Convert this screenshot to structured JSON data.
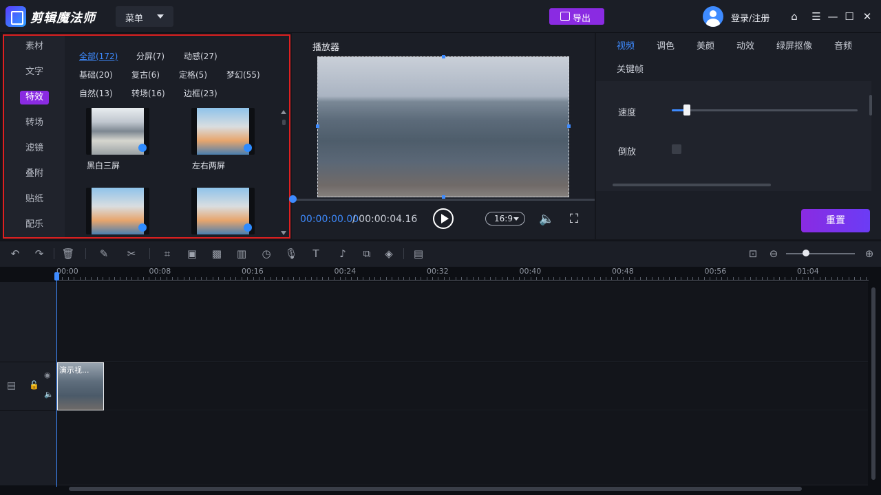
{
  "app": {
    "title": "剪辑魔法师",
    "menu_label": "菜单",
    "export_label": "导出",
    "login_label": "登录/注册"
  },
  "left": {
    "categories": [
      "素材",
      "文字",
      "特效",
      "转场",
      "滤镜",
      "叠附",
      "贴纸",
      "配乐"
    ],
    "active_category": "特效",
    "tags": [
      "全部(172)",
      "分屏(7)",
      "动感(27)",
      "基础(20)",
      "复古(6)",
      "定格(5)",
      "梦幻(55)",
      "自然(13)",
      "转场(16)",
      "边框(23)"
    ],
    "active_tag": "全部(172)",
    "effects": [
      "黑白三屏",
      "左右两屏"
    ]
  },
  "player": {
    "title": "播放器",
    "current_time": "00:00:00.00",
    "total_time": "/ 00:00:04.16",
    "aspect": "16:9"
  },
  "props": {
    "tabs": [
      "视频",
      "调色",
      "美颜",
      "动效",
      "绿屏抠像",
      "音频",
      "关键帧"
    ],
    "active_tab": "视频",
    "speed_label": "速度",
    "speed_value": 0.08,
    "reverse_label": "倒放",
    "reset_label": "重置"
  },
  "timeline": {
    "ticks": [
      "00:00",
      "00:08",
      "00:16",
      "00:24",
      "00:32",
      "00:40",
      "00:48",
      "00:56",
      "01:04"
    ],
    "clip_label": "演示视..."
  },
  "colors": {
    "accent_purple": "#8a2be2",
    "accent_blue": "#3e8bff",
    "highlight_border": "#e02020"
  }
}
